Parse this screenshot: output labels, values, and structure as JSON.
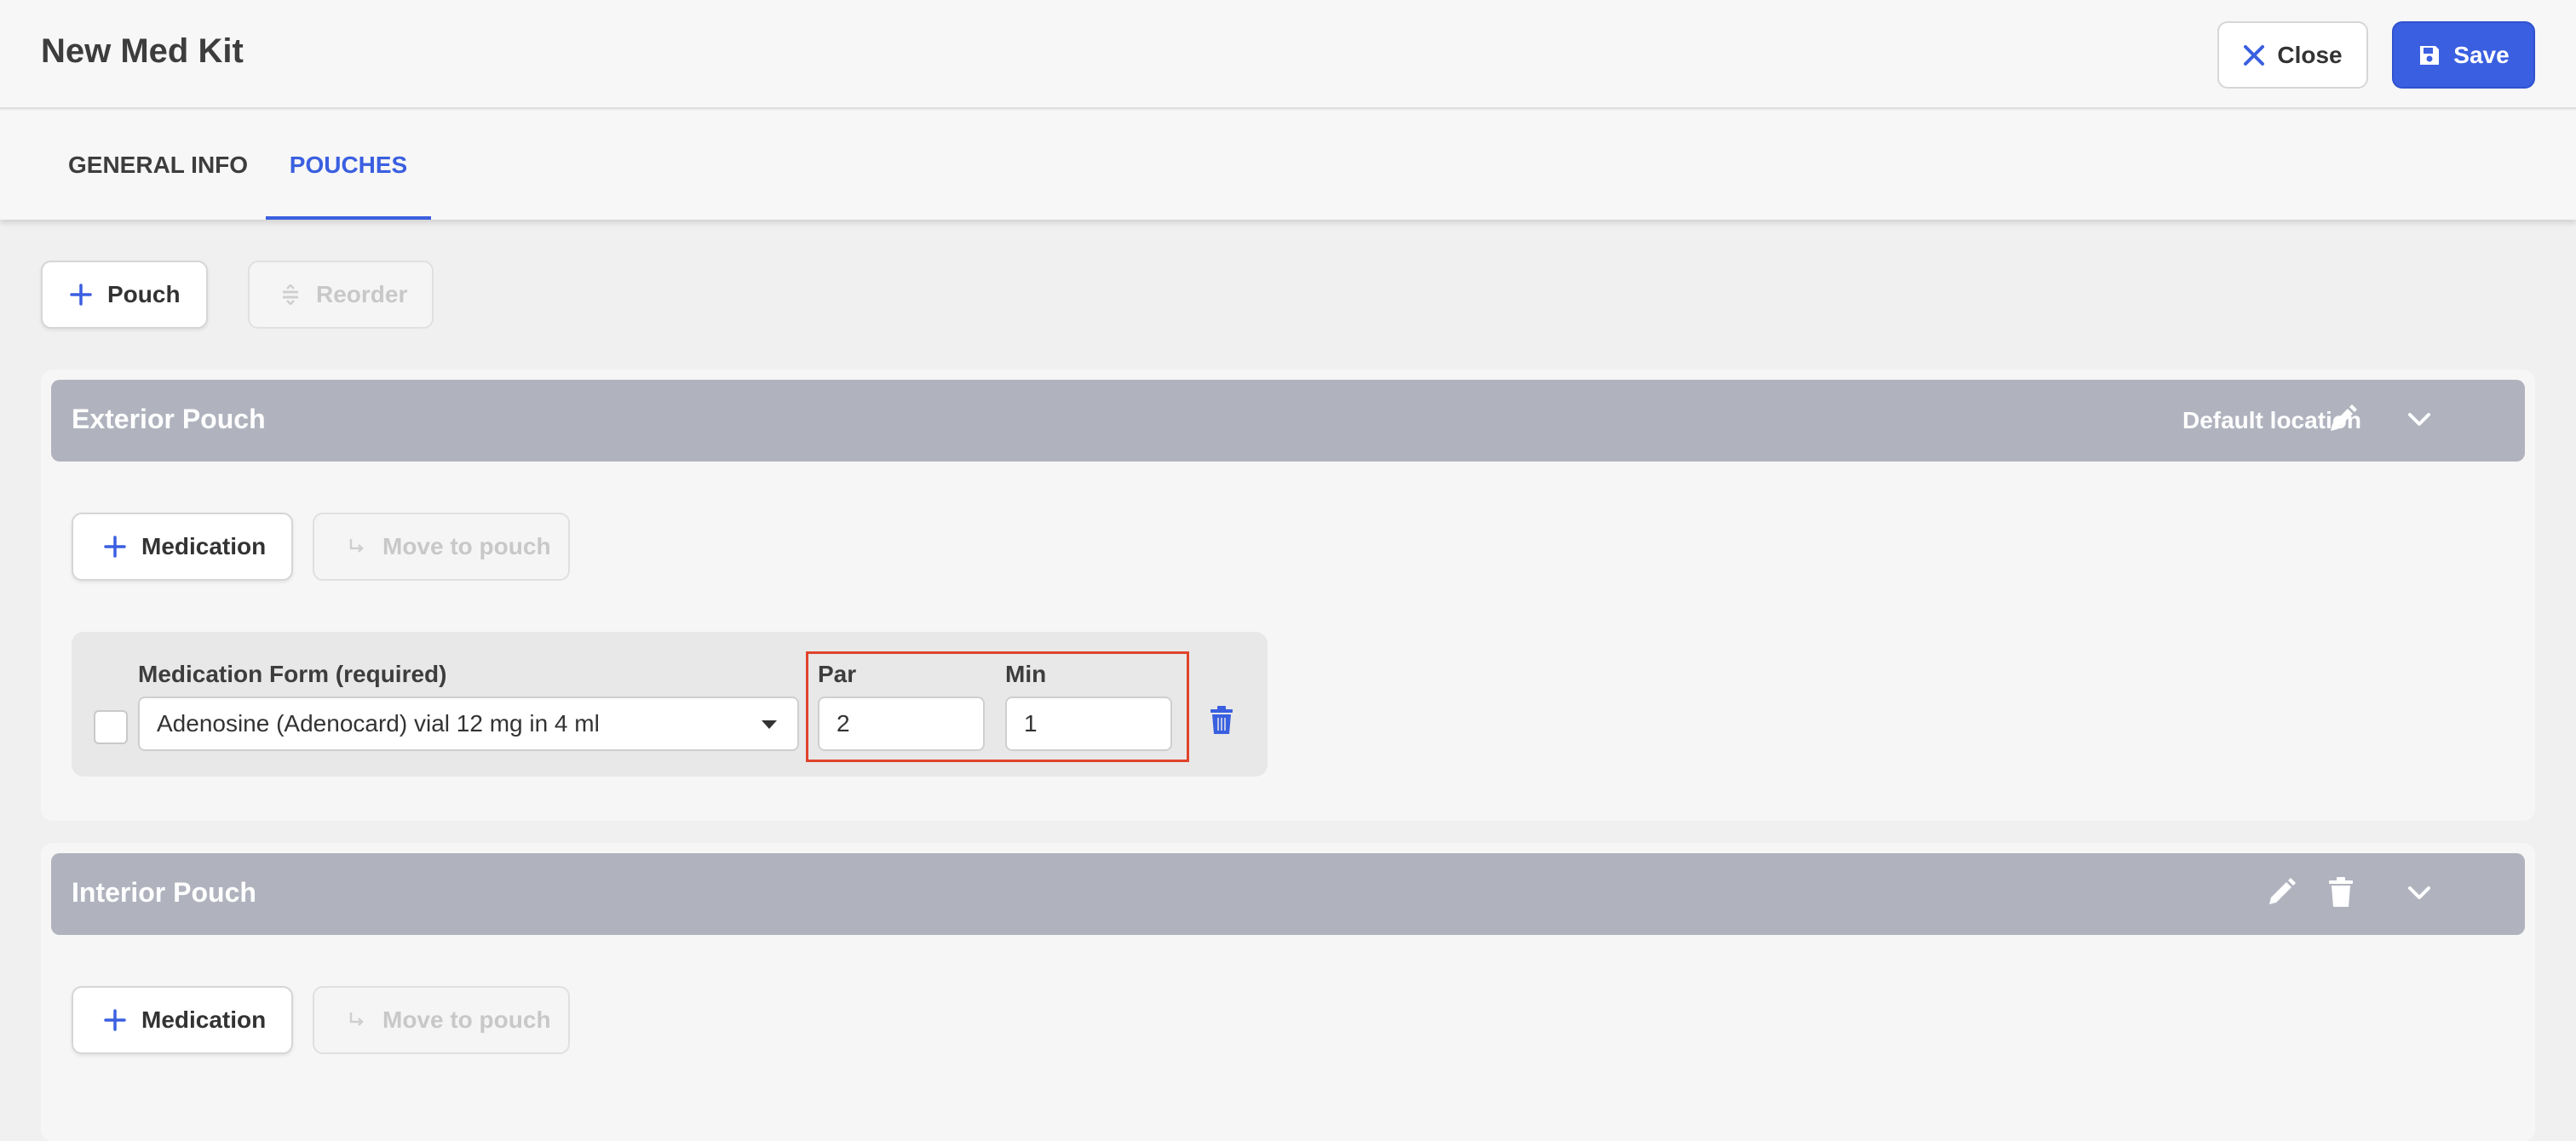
{
  "header": {
    "title": "New Med Kit",
    "close_label": "Close",
    "save_label": "Save"
  },
  "tabs": [
    {
      "label": "GENERAL INFO",
      "active": false
    },
    {
      "label": "POUCHES",
      "active": true
    }
  ],
  "toolbar": {
    "add_pouch_label": "Pouch",
    "reorder_label": "Reorder"
  },
  "pouches": [
    {
      "title": "Exterior Pouch",
      "location": "Default location",
      "add_medication_label": "Medication",
      "move_to_pouch_label": "Move to pouch",
      "medications": [
        {
          "form_label": "Medication Form (required)",
          "form_value": "Adenosine (Adenocard) vial 12 mg in 4 ml",
          "par_label": "Par",
          "par_value": "2",
          "min_label": "Min",
          "min_value": "1",
          "checked": false
        }
      ]
    },
    {
      "title": "Interior Pouch",
      "add_medication_label": "Medication",
      "move_to_pouch_label": "Move to pouch",
      "medications": []
    }
  ],
  "colors": {
    "accent": "#3a5fe0",
    "pouch_header": "#b0b3be",
    "highlight": "#e0432b"
  },
  "icons": [
    "close-icon",
    "save-icon",
    "plus-icon",
    "reorder-icon",
    "pencil-icon",
    "chevron-down-icon",
    "move-arrow-icon",
    "trash-icon",
    "dropdown-caret-icon"
  ]
}
